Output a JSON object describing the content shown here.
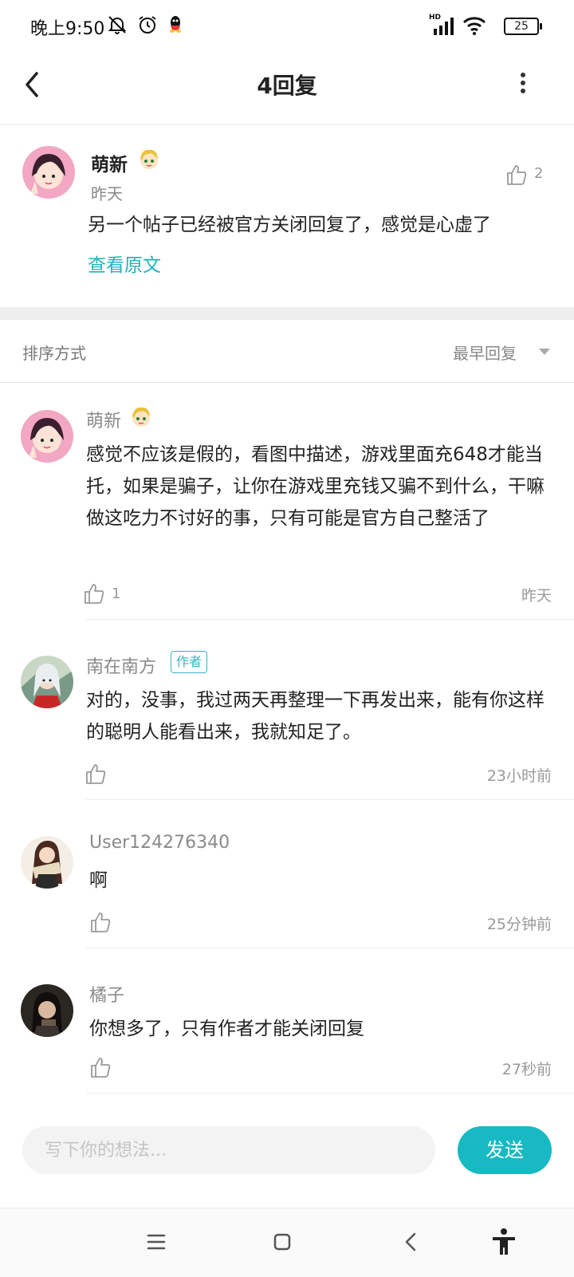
{
  "status_bar": {
    "time": "晚上9:50",
    "network": "HD",
    "battery": "25"
  },
  "header": {
    "title": "4回复"
  },
  "original_post": {
    "author": "萌新",
    "date": "昨天",
    "text": "另一个帖子已经被官方关闭回复了，感觉是心虚了",
    "view_original": "查看原文",
    "likes": "2"
  },
  "sort": {
    "label": "排序方式",
    "value": "最早回复"
  },
  "replies": [
    {
      "author": "萌新",
      "text": "感觉不应该是假的，看图中描述，游戏里面充648才能当托，如果是骗子，让你在游戏里充钱又骗不到什么，干嘛做这吃力不讨好的事，只有可能是官方自己整活了",
      "likes": "1",
      "time": "昨天"
    },
    {
      "author": "南在南方",
      "badge": "作者",
      "text": "对的，没事，我过两天再整理一下再发出来，能有你这样的聪明人能看出来，我就知足了。",
      "likes": "",
      "time": "23小时前"
    },
    {
      "author": "User124276340",
      "text": "啊",
      "likes": "",
      "time": "25分钟前"
    },
    {
      "author": "橘子",
      "text": "你想多了，只有作者才能关闭回复",
      "likes": "",
      "time": "27秒前"
    }
  ],
  "composer": {
    "placeholder": "写下你的想法...",
    "send_label": "发送"
  },
  "colors": {
    "accent": "#17b9c3",
    "link": "#1fb3b9"
  }
}
